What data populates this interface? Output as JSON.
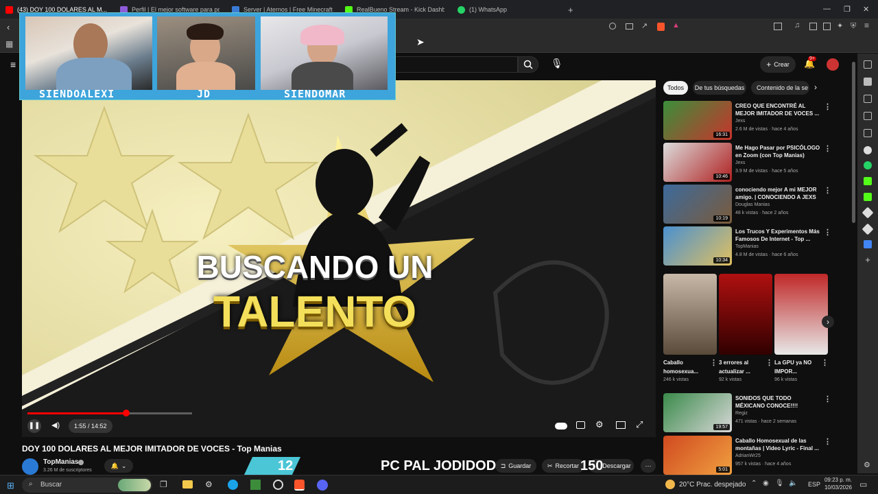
{
  "browser": {
    "tabs": [
      {
        "label": "(43) DOY 100 DOLARES AL M...",
        "color": "#ff0000"
      },
      {
        "label": "Perfil | El mejor software para potenc...",
        "color": "#8e5bd8"
      },
      {
        "label": "Server | Aternos | Free Minecraft Serv...",
        "color": "#3a7bd5"
      },
      {
        "label": "RealBueno Stream - Kick Dashbo...",
        "color": "#53fc18"
      },
      {
        "label": "(1) WhatsApp",
        "color": "#25d366"
      }
    ],
    "new_tab": "+"
  },
  "youtube": {
    "create_label": "Crear",
    "notif_count": "9+",
    "search_partial": "s"
  },
  "video": {
    "title": "DOY 100 DOLARES AL MEJOR IMITADOR DE VOCES - Top Manias",
    "thumb_line1": "BUSCANDO UN",
    "thumb_line2": "TALENTO",
    "time": "1:55 / 14:52",
    "progress": 0.136,
    "channel": "TopManias",
    "subs": "3.26 M de suscriptores",
    "save_label": "Guardar",
    "clip_label": "Recortar",
    "download_label": "Descargar"
  },
  "overlay": {
    "cam1": "SIENDOALEXI",
    "cam2": "JD",
    "cam3": "SIENDOMAR",
    "score_left": "12",
    "banner": "PC PAL JODIDOD",
    "score_right": "150"
  },
  "chips": [
    "Todos",
    "De tus búsquedas",
    "Contenido de la se"
  ],
  "recommended": [
    {
      "title": "CREO QUE ENCONTRÉ AL MEJOR IMITADOR DE VOCES ...",
      "channel": "Jexs",
      "meta": "2.6 M de vistas · hace 4 años",
      "duration": "16:31",
      "c1": "#3a8f3a",
      "c2": "#c8342c"
    },
    {
      "title": "Me Hago Pasar por PSICÓLOGO en Zoom (con Top Manias)",
      "channel": "Jexs",
      "meta": "3.9 M de vistas · hace 5 años",
      "duration": "10:46",
      "c1": "#dcdcdc",
      "c2": "#b02020"
    },
    {
      "title": "conociendo mejor A mi MEJOR amigo. | CONOCIENDO A JEXS",
      "channel": "Douglas Manias",
      "meta": "48 k vistas · hace 2 años",
      "duration": "10:19",
      "c1": "#3c6a9c",
      "c2": "#7b5b3b"
    },
    {
      "title": "Los Trucos Y Experimentos Más Famosos De Internet - Top ...",
      "channel": "TopManias",
      "meta": "4.8 M de vistas · hace 6 años",
      "duration": "10:34",
      "c1": "#4a90d0",
      "c2": "#e0c060"
    }
  ],
  "shorts": [
    {
      "label": "Caballo homosexua...",
      "views": "246 k vistas",
      "c1": "#c8b8a8",
      "c2": "#5a4a3a"
    },
    {
      "label": "3 errores al actualizar ...",
      "views": "92 k vistas",
      "c1": "#b01010",
      "c2": "#300000"
    },
    {
      "label": "La GPU ya NO IMPOR...",
      "views": "96 k vistas",
      "c1": "#c02828",
      "c2": "#e8e8e8"
    }
  ],
  "recommended2": [
    {
      "title": "SONIDOS QUE TODO MÉXICANO CONOCE!!!!",
      "channel": "Regiz",
      "meta": "471 vistas · hace 2 semanas",
      "duration": "19:57",
      "c1": "#3a8a4a",
      "c2": "#d8d8d8"
    },
    {
      "title": "Caballo Homosexual de las montañas | Video Lyric - Final ...",
      "channel": "AdrianWr25",
      "meta": "957 k vistas · hace 4 años",
      "duration": "5:01",
      "c1": "#d04a20",
      "c2": "#f0a040"
    }
  ],
  "taskbar": {
    "search": "Buscar",
    "weather": "20°C  Prac. despejado",
    "lang": "ESP",
    "time": "09:23 p. m.",
    "date": "10/03/2026"
  }
}
